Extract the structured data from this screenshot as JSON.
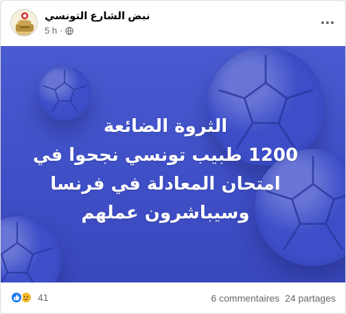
{
  "post": {
    "page_name": "نبض الشارع التونسي",
    "time": "5 h",
    "separator": "·",
    "headline_lines": [
      "الثروة الضائعة",
      "1200 طبيب تونسي نجحوا في",
      "امتحان المعادلة في فرنسا",
      "وسيباشرون عملهم"
    ]
  },
  "footer": {
    "reaction_count": "41",
    "comments": "6 commentaires",
    "shares": "24 partages"
  },
  "icons": {
    "avatar": "page-logo-icon",
    "privacy": "globe-icon",
    "more": "more-options-icon",
    "like": "like-reaction-icon",
    "sad": "sad-reaction-icon"
  },
  "colors": {
    "background": "#4a5bd1",
    "like_blue": "#1877f2",
    "sad_yellow": "#f7b928",
    "meta_gray": "#65676b"
  }
}
